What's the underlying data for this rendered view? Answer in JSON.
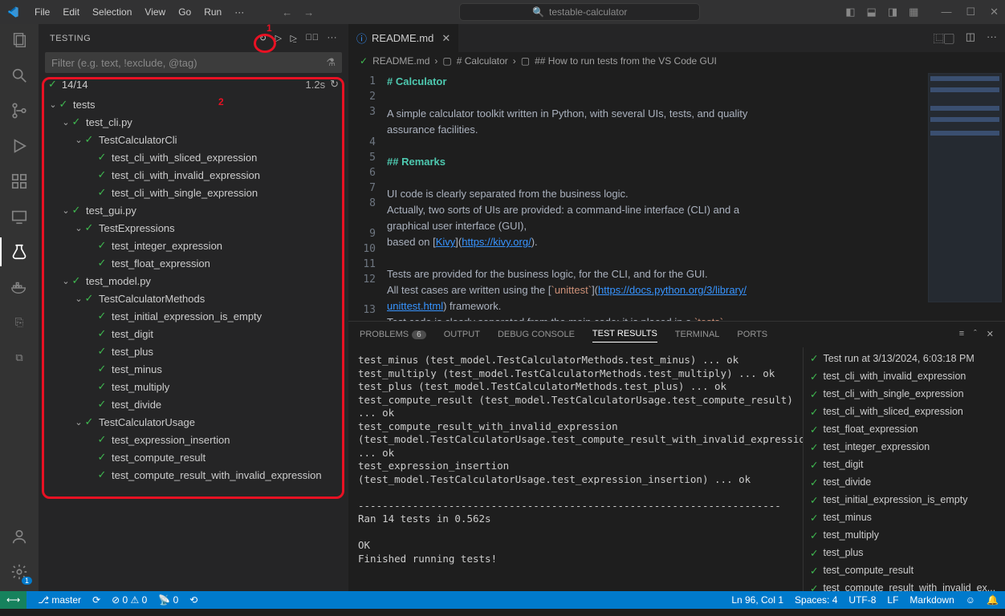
{
  "menu": [
    "File",
    "Edit",
    "Selection",
    "View",
    "Go",
    "Run",
    "···"
  ],
  "search_placeholder": "testable-calculator",
  "sidebar": {
    "title": "TESTING",
    "filter_placeholder": "Filter (e.g. text, !exclude, @tag)",
    "summary": {
      "count": "14/14",
      "time": "1.2s"
    }
  },
  "tree": [
    {
      "d": 0,
      "c": true,
      "label": "tests"
    },
    {
      "d": 1,
      "c": true,
      "label": "test_cli.py"
    },
    {
      "d": 2,
      "c": true,
      "label": "TestCalculatorCli"
    },
    {
      "d": 3,
      "c": false,
      "label": "test_cli_with_sliced_expression"
    },
    {
      "d": 3,
      "c": false,
      "label": "test_cli_with_invalid_expression"
    },
    {
      "d": 3,
      "c": false,
      "label": "test_cli_with_single_expression"
    },
    {
      "d": 1,
      "c": true,
      "label": "test_gui.py"
    },
    {
      "d": 2,
      "c": true,
      "label": "TestExpressions"
    },
    {
      "d": 3,
      "c": false,
      "label": "test_integer_expression"
    },
    {
      "d": 3,
      "c": false,
      "label": "test_float_expression"
    },
    {
      "d": 1,
      "c": true,
      "label": "test_model.py"
    },
    {
      "d": 2,
      "c": true,
      "label": "TestCalculatorMethods"
    },
    {
      "d": 3,
      "c": false,
      "label": "test_initial_expression_is_empty"
    },
    {
      "d": 3,
      "c": false,
      "label": "test_digit"
    },
    {
      "d": 3,
      "c": false,
      "label": "test_plus"
    },
    {
      "d": 3,
      "c": false,
      "label": "test_minus"
    },
    {
      "d": 3,
      "c": false,
      "label": "test_multiply"
    },
    {
      "d": 3,
      "c": false,
      "label": "test_divide"
    },
    {
      "d": 2,
      "c": true,
      "label": "TestCalculatorUsage"
    },
    {
      "d": 3,
      "c": false,
      "label": "test_expression_insertion"
    },
    {
      "d": 3,
      "c": false,
      "label": "test_compute_result"
    },
    {
      "d": 3,
      "c": false,
      "label": "test_compute_result_with_invalid_expression"
    }
  ],
  "tab": {
    "name": "README.md"
  },
  "breadcrumb": [
    "README.md",
    "# Calculator",
    "## How to run tests from the VS Code GUI"
  ],
  "code_lines": [
    {
      "n": 1,
      "cls": "h1",
      "t": "# Calculator"
    },
    {
      "n": 2,
      "cls": "",
      "t": ""
    },
    {
      "n": 3,
      "cls": "",
      "t": "A simple calculator toolkit written in Python, with several UIs, tests, and quality   "
    },
    {
      "n": "",
      "cls": "",
      "t": "assurance facilities."
    },
    {
      "n": 4,
      "cls": "",
      "t": ""
    },
    {
      "n": 5,
      "cls": "h2",
      "t": "## Remarks"
    },
    {
      "n": 6,
      "cls": "",
      "t": ""
    },
    {
      "n": 7,
      "cls": "",
      "t": "UI code is clearly separated from the business logic."
    },
    {
      "n": 8,
      "cls": "",
      "t": "Actually, two sorts of UIs are provided: a command-line interface (CLI) and a "
    },
    {
      "n": "",
      "cls": "",
      "t": "graphical user interface (GUI), "
    },
    {
      "n": 9,
      "cls": "",
      "t": "based on [<span class='link'>Kivy</span>](<span class='link'>https://kivy.org/</span>)."
    },
    {
      "n": 10,
      "cls": "",
      "t": ""
    },
    {
      "n": 11,
      "cls": "",
      "t": "Tests are provided for the business logic, for the CLI, and for the GUI."
    },
    {
      "n": 12,
      "cls": "",
      "t": "All test cases are written using the [<span class='str'>`unittest`</span>](<span class='link'>https://docs.python.org/3/library/</span>"
    },
    {
      "n": "",
      "cls": "",
      "t": "<span class='link'>unittest.html</span>) framework."
    },
    {
      "n": 13,
      "cls": "",
      "t": "Test code is clearly separated from the main code: it is placed in a <span class='str'>`tests`</span>"
    }
  ],
  "panel_tabs": {
    "problems": "PROBLEMS",
    "problems_count": "6",
    "output": "OUTPUT",
    "debug": "DEBUG CONSOLE",
    "results": "TEST RESULTS",
    "terminal": "TERMINAL",
    "ports": "PORTS"
  },
  "terminal_text": "test_minus (test_model.TestCalculatorMethods.test_minus) ... ok\ntest_multiply (test_model.TestCalculatorMethods.test_multiply) ... ok\ntest_plus (test_model.TestCalculatorMethods.test_plus) ... ok\ntest_compute_result (test_model.TestCalculatorUsage.test_compute_result) ... ok\ntest_compute_result_with_invalid_expression (test_model.TestCalculatorUsage.test_compute_result_with_invalid_expression) ... ok\ntest_expression_insertion (test_model.TestCalculatorUsage.test_expression_insertion) ... ok\n\n----------------------------------------------------------------------\nRan 14 tests in 0.562s\n\nOK\nFinished running tests!",
  "results": {
    "head": "Test run at 3/13/2024, 6:03:18 PM",
    "items": [
      "test_cli_with_invalid_expression",
      "test_cli_with_single_expression",
      "test_cli_with_sliced_expression",
      "test_float_expression",
      "test_integer_expression",
      "test_digit",
      "test_divide",
      "test_initial_expression_is_empty",
      "test_minus",
      "test_multiply",
      "test_plus",
      "test_compute_result",
      "test_compute_result_with_invalid_ex..."
    ]
  },
  "status": {
    "branch": "master",
    "errors": "0",
    "warnings": "0",
    "ports": "0",
    "ln": "Ln 96, Col 1",
    "spaces": "Spaces: 4",
    "enc": "UTF-8",
    "eol": "LF",
    "lang": "Markdown"
  },
  "annotations": {
    "label1": "1",
    "label2": "2"
  }
}
